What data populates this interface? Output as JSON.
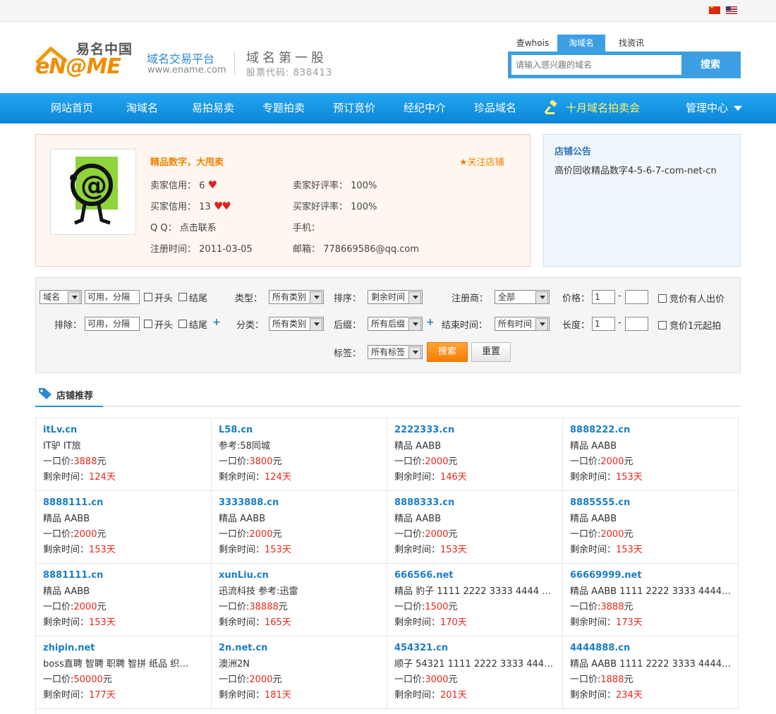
{
  "header": {
    "logo_cn": "易名中国",
    "logo_en": "eN@ME",
    "slogan": "域名交易平台",
    "url": "www.ename.com",
    "stock": "域名第一股",
    "stock_code": "股票代码: 838413",
    "search_tabs": [
      "查whois",
      "淘域名",
      "找资讯"
    ],
    "active_search_tab": "淘域名",
    "search_placeholder": "请输入感兴趣的域名",
    "search_button": "搜索"
  },
  "nav": {
    "items": [
      "网站首页",
      "淘域名",
      "易拍易卖",
      "专题拍卖",
      "预订竞价",
      "经纪中介",
      "珍品域名"
    ],
    "auction_label": "十月域名拍卖会",
    "manage_label": "管理中心",
    "auction_color": "#fff56b"
  },
  "shop": {
    "name": "精品数字，大甩卖",
    "follow": "★关注店铺",
    "seller_credit_label": "卖家信用：",
    "seller_credit": "6",
    "buyer_credit_label": "买家信用：",
    "buyer_credit": "13",
    "qq_label": "Q Q：",
    "qq_value": "点击联系",
    "reg_label": "注册时间：",
    "reg_date": "2011-03-05",
    "seller_rate_label": "卖家好评率：",
    "seller_rate": "100%",
    "buyer_rate_label": "买家好评率：",
    "buyer_rate": "100%",
    "phone_label": "手机：",
    "email_label": "邮箱：",
    "email": "778669586@qq.com"
  },
  "notice": {
    "title": "店铺公告",
    "text": "高价回收精品数字4-5-6-7-com-net-cn"
  },
  "filter": {
    "domain_select": "域名",
    "include_value": "可用，分隔",
    "exclude_label": "排除：",
    "exclude_value": "可用，分隔",
    "start_label": "开头",
    "end_label": "结尾",
    "type_label": "类型：",
    "type_value": "所有类别",
    "category_label": "分类：",
    "category_value": "所有类别",
    "sort_label": "排序：",
    "sort_value": "剩余时间",
    "suffix_label": "后缀：",
    "suffix_value": "所有后缀",
    "registrar_label": "注册商：",
    "registrar_value": "全部",
    "endtime_label": "结束时间：",
    "endtime_value": "所有时间",
    "price_label": "价格：",
    "price_from": "1",
    "length_label": "长度：",
    "length_from": "1",
    "dash": "-",
    "bid_has_label": "竞价有人出价",
    "bid_one_label": "竞价1元起拍",
    "tag_label": "标签：",
    "tag_value": "所有标签",
    "search_button": "搜索",
    "reset_button": "重置",
    "plus": "+"
  },
  "recommend": {
    "title": "店铺推荐",
    "price_label": "一口价:",
    "price_unit": "元",
    "time_label": "剩余时间：",
    "time_unit": "天",
    "items": [
      {
        "name": "itLv.cn",
        "desc": "IT驴 IT旅",
        "price": "3888",
        "days": "124"
      },
      {
        "name": "L58.cn",
        "desc": "参考:58同城",
        "price": "3800",
        "days": "124"
      },
      {
        "name": "2222333.cn",
        "desc": "精品 AABB",
        "price": "2000",
        "days": "146"
      },
      {
        "name": "8888222.cn",
        "desc": "精品 AABB",
        "price": "2000",
        "days": "153"
      },
      {
        "name": "8888111.cn",
        "desc": "精品 AABB",
        "price": "2000",
        "days": "153"
      },
      {
        "name": "3333888.cn",
        "desc": "精品 AABB",
        "price": "2000",
        "days": "153"
      },
      {
        "name": "8888333.cn",
        "desc": "精品 AABB",
        "price": "2000",
        "days": "153"
      },
      {
        "name": "8885555.cn",
        "desc": "精品 AABB",
        "price": "2000",
        "days": "153"
      },
      {
        "name": "8881111.cn",
        "desc": "精品 AABB",
        "price": "2000",
        "days": "153"
      },
      {
        "name": "xunLiu.cn",
        "desc": "迅流科技 参考:迅雷",
        "price": "38888",
        "days": "165"
      },
      {
        "name": "666566.net",
        "desc": "精品 豹子 1111 2222 3333 4444 5…",
        "price": "1500",
        "days": "170"
      },
      {
        "name": "66669999.net",
        "desc": "精品 AABB 1111 2222 3333 4444…",
        "price": "3888",
        "days": "173"
      },
      {
        "name": "zhipin.net",
        "desc": "boss直聘 智聘 职聘 智拼 纸品 织…",
        "price": "50000",
        "days": "177"
      },
      {
        "name": "2n.net.cn",
        "desc": "澳洲2N",
        "price": "2000",
        "days": "181"
      },
      {
        "name": "454321.cn",
        "desc": "顺子 54321 1111 2222 3333 4444…",
        "price": "3000",
        "days": "201"
      },
      {
        "name": "4444888.cn",
        "desc": "精品 AABB 1111 2222 3333 4444…",
        "price": "1888",
        "days": "234"
      }
    ]
  }
}
